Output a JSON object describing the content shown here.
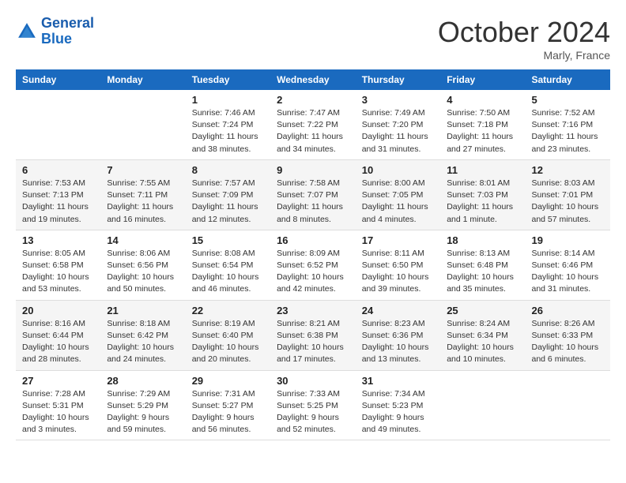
{
  "header": {
    "logo_line1": "General",
    "logo_line2": "Blue",
    "month": "October 2024",
    "location": "Marly, France"
  },
  "weekdays": [
    "Sunday",
    "Monday",
    "Tuesday",
    "Wednesday",
    "Thursday",
    "Friday",
    "Saturday"
  ],
  "weeks": [
    [
      {
        "day": "",
        "sunrise": "",
        "sunset": "",
        "daylight": ""
      },
      {
        "day": "",
        "sunrise": "",
        "sunset": "",
        "daylight": ""
      },
      {
        "day": "1",
        "sunrise": "Sunrise: 7:46 AM",
        "sunset": "Sunset: 7:24 PM",
        "daylight": "Daylight: 11 hours and 38 minutes."
      },
      {
        "day": "2",
        "sunrise": "Sunrise: 7:47 AM",
        "sunset": "Sunset: 7:22 PM",
        "daylight": "Daylight: 11 hours and 34 minutes."
      },
      {
        "day": "3",
        "sunrise": "Sunrise: 7:49 AM",
        "sunset": "Sunset: 7:20 PM",
        "daylight": "Daylight: 11 hours and 31 minutes."
      },
      {
        "day": "4",
        "sunrise": "Sunrise: 7:50 AM",
        "sunset": "Sunset: 7:18 PM",
        "daylight": "Daylight: 11 hours and 27 minutes."
      },
      {
        "day": "5",
        "sunrise": "Sunrise: 7:52 AM",
        "sunset": "Sunset: 7:16 PM",
        "daylight": "Daylight: 11 hours and 23 minutes."
      }
    ],
    [
      {
        "day": "6",
        "sunrise": "Sunrise: 7:53 AM",
        "sunset": "Sunset: 7:13 PM",
        "daylight": "Daylight: 11 hours and 19 minutes."
      },
      {
        "day": "7",
        "sunrise": "Sunrise: 7:55 AM",
        "sunset": "Sunset: 7:11 PM",
        "daylight": "Daylight: 11 hours and 16 minutes."
      },
      {
        "day": "8",
        "sunrise": "Sunrise: 7:57 AM",
        "sunset": "Sunset: 7:09 PM",
        "daylight": "Daylight: 11 hours and 12 minutes."
      },
      {
        "day": "9",
        "sunrise": "Sunrise: 7:58 AM",
        "sunset": "Sunset: 7:07 PM",
        "daylight": "Daylight: 11 hours and 8 minutes."
      },
      {
        "day": "10",
        "sunrise": "Sunrise: 8:00 AM",
        "sunset": "Sunset: 7:05 PM",
        "daylight": "Daylight: 11 hours and 4 minutes."
      },
      {
        "day": "11",
        "sunrise": "Sunrise: 8:01 AM",
        "sunset": "Sunset: 7:03 PM",
        "daylight": "Daylight: 11 hours and 1 minute."
      },
      {
        "day": "12",
        "sunrise": "Sunrise: 8:03 AM",
        "sunset": "Sunset: 7:01 PM",
        "daylight": "Daylight: 10 hours and 57 minutes."
      }
    ],
    [
      {
        "day": "13",
        "sunrise": "Sunrise: 8:05 AM",
        "sunset": "Sunset: 6:58 PM",
        "daylight": "Daylight: 10 hours and 53 minutes."
      },
      {
        "day": "14",
        "sunrise": "Sunrise: 8:06 AM",
        "sunset": "Sunset: 6:56 PM",
        "daylight": "Daylight: 10 hours and 50 minutes."
      },
      {
        "day": "15",
        "sunrise": "Sunrise: 8:08 AM",
        "sunset": "Sunset: 6:54 PM",
        "daylight": "Daylight: 10 hours and 46 minutes."
      },
      {
        "day": "16",
        "sunrise": "Sunrise: 8:09 AM",
        "sunset": "Sunset: 6:52 PM",
        "daylight": "Daylight: 10 hours and 42 minutes."
      },
      {
        "day": "17",
        "sunrise": "Sunrise: 8:11 AM",
        "sunset": "Sunset: 6:50 PM",
        "daylight": "Daylight: 10 hours and 39 minutes."
      },
      {
        "day": "18",
        "sunrise": "Sunrise: 8:13 AM",
        "sunset": "Sunset: 6:48 PM",
        "daylight": "Daylight: 10 hours and 35 minutes."
      },
      {
        "day": "19",
        "sunrise": "Sunrise: 8:14 AM",
        "sunset": "Sunset: 6:46 PM",
        "daylight": "Daylight: 10 hours and 31 minutes."
      }
    ],
    [
      {
        "day": "20",
        "sunrise": "Sunrise: 8:16 AM",
        "sunset": "Sunset: 6:44 PM",
        "daylight": "Daylight: 10 hours and 28 minutes."
      },
      {
        "day": "21",
        "sunrise": "Sunrise: 8:18 AM",
        "sunset": "Sunset: 6:42 PM",
        "daylight": "Daylight: 10 hours and 24 minutes."
      },
      {
        "day": "22",
        "sunrise": "Sunrise: 8:19 AM",
        "sunset": "Sunset: 6:40 PM",
        "daylight": "Daylight: 10 hours and 20 minutes."
      },
      {
        "day": "23",
        "sunrise": "Sunrise: 8:21 AM",
        "sunset": "Sunset: 6:38 PM",
        "daylight": "Daylight: 10 hours and 17 minutes."
      },
      {
        "day": "24",
        "sunrise": "Sunrise: 8:23 AM",
        "sunset": "Sunset: 6:36 PM",
        "daylight": "Daylight: 10 hours and 13 minutes."
      },
      {
        "day": "25",
        "sunrise": "Sunrise: 8:24 AM",
        "sunset": "Sunset: 6:34 PM",
        "daylight": "Daylight: 10 hours and 10 minutes."
      },
      {
        "day": "26",
        "sunrise": "Sunrise: 8:26 AM",
        "sunset": "Sunset: 6:33 PM",
        "daylight": "Daylight: 10 hours and 6 minutes."
      }
    ],
    [
      {
        "day": "27",
        "sunrise": "Sunrise: 7:28 AM",
        "sunset": "Sunset: 5:31 PM",
        "daylight": "Daylight: 10 hours and 3 minutes."
      },
      {
        "day": "28",
        "sunrise": "Sunrise: 7:29 AM",
        "sunset": "Sunset: 5:29 PM",
        "daylight": "Daylight: 9 hours and 59 minutes."
      },
      {
        "day": "29",
        "sunrise": "Sunrise: 7:31 AM",
        "sunset": "Sunset: 5:27 PM",
        "daylight": "Daylight: 9 hours and 56 minutes."
      },
      {
        "day": "30",
        "sunrise": "Sunrise: 7:33 AM",
        "sunset": "Sunset: 5:25 PM",
        "daylight": "Daylight: 9 hours and 52 minutes."
      },
      {
        "day": "31",
        "sunrise": "Sunrise: 7:34 AM",
        "sunset": "Sunset: 5:23 PM",
        "daylight": "Daylight: 9 hours and 49 minutes."
      },
      {
        "day": "",
        "sunrise": "",
        "sunset": "",
        "daylight": ""
      },
      {
        "day": "",
        "sunrise": "",
        "sunset": "",
        "daylight": ""
      }
    ]
  ]
}
